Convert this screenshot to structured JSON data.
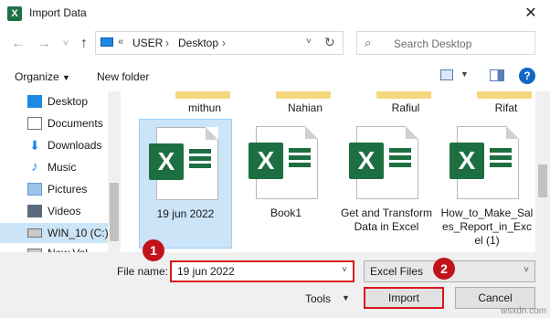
{
  "window": {
    "title": "Import Data",
    "app_icon": "excel-icon",
    "close_glyph": "✕"
  },
  "nav": {
    "back_glyph": "←",
    "forward_glyph": "→",
    "recent_glyph": "˅",
    "up_glyph": "↑",
    "address": {
      "overflow": "«",
      "crumbs": [
        "USER",
        "Desktop"
      ],
      "separator": "›",
      "dropdown_glyph": "˅",
      "refresh_glyph": "↻"
    },
    "search": {
      "placeholder": "Search Desktop"
    }
  },
  "toolbar": {
    "organize_label": "Organize",
    "organize_dd": "▼",
    "new_folder_label": "New folder",
    "view_dd": "▼",
    "help_label": "?"
  },
  "sidebar": {
    "items": [
      {
        "label": "Desktop",
        "icon": "desktop-icon",
        "color": "#1e88e5"
      },
      {
        "label": "Documents",
        "icon": "documents-icon",
        "color": "#6a7a8c"
      },
      {
        "label": "Downloads",
        "icon": "downloads-icon",
        "color": "#1e88e5"
      },
      {
        "label": "Music",
        "icon": "music-icon",
        "color": "#1e88e5"
      },
      {
        "label": "Pictures",
        "icon": "pictures-icon",
        "color": "#6a9bd1"
      },
      {
        "label": "Videos",
        "icon": "videos-icon",
        "color": "#5a6b7c"
      },
      {
        "label": "WIN_10 (C:)",
        "icon": "drive-icon",
        "color": "#707070"
      },
      {
        "label": "New Vol",
        "icon": "drive-icon",
        "color": "#707070"
      }
    ]
  },
  "files": {
    "folders_row": [
      "mithun",
      "Nahian",
      "Rafiul",
      "Rifat"
    ],
    "items": [
      {
        "name": "19 jun 2022",
        "selected": true
      },
      {
        "name": "Book1",
        "selected": false
      },
      {
        "name": "Get and Transform Data in Excel",
        "selected": false
      },
      {
        "name": "How_to_Make_Sales_Report_in_Excel (1)",
        "selected": false
      }
    ]
  },
  "footer": {
    "file_name_label": "File name:",
    "file_name_value": "19 jun 2022",
    "file_type_value": "Excel Files",
    "tools_label": "Tools",
    "tools_dd": "▼",
    "import_label": "Import",
    "cancel_label": "Cancel",
    "dropdown_glyph": "˅"
  },
  "annotations": {
    "badge_1": "1",
    "badge_2": "2",
    "highlight_color": "#d9161c"
  },
  "watermark": "wsxdn.com"
}
